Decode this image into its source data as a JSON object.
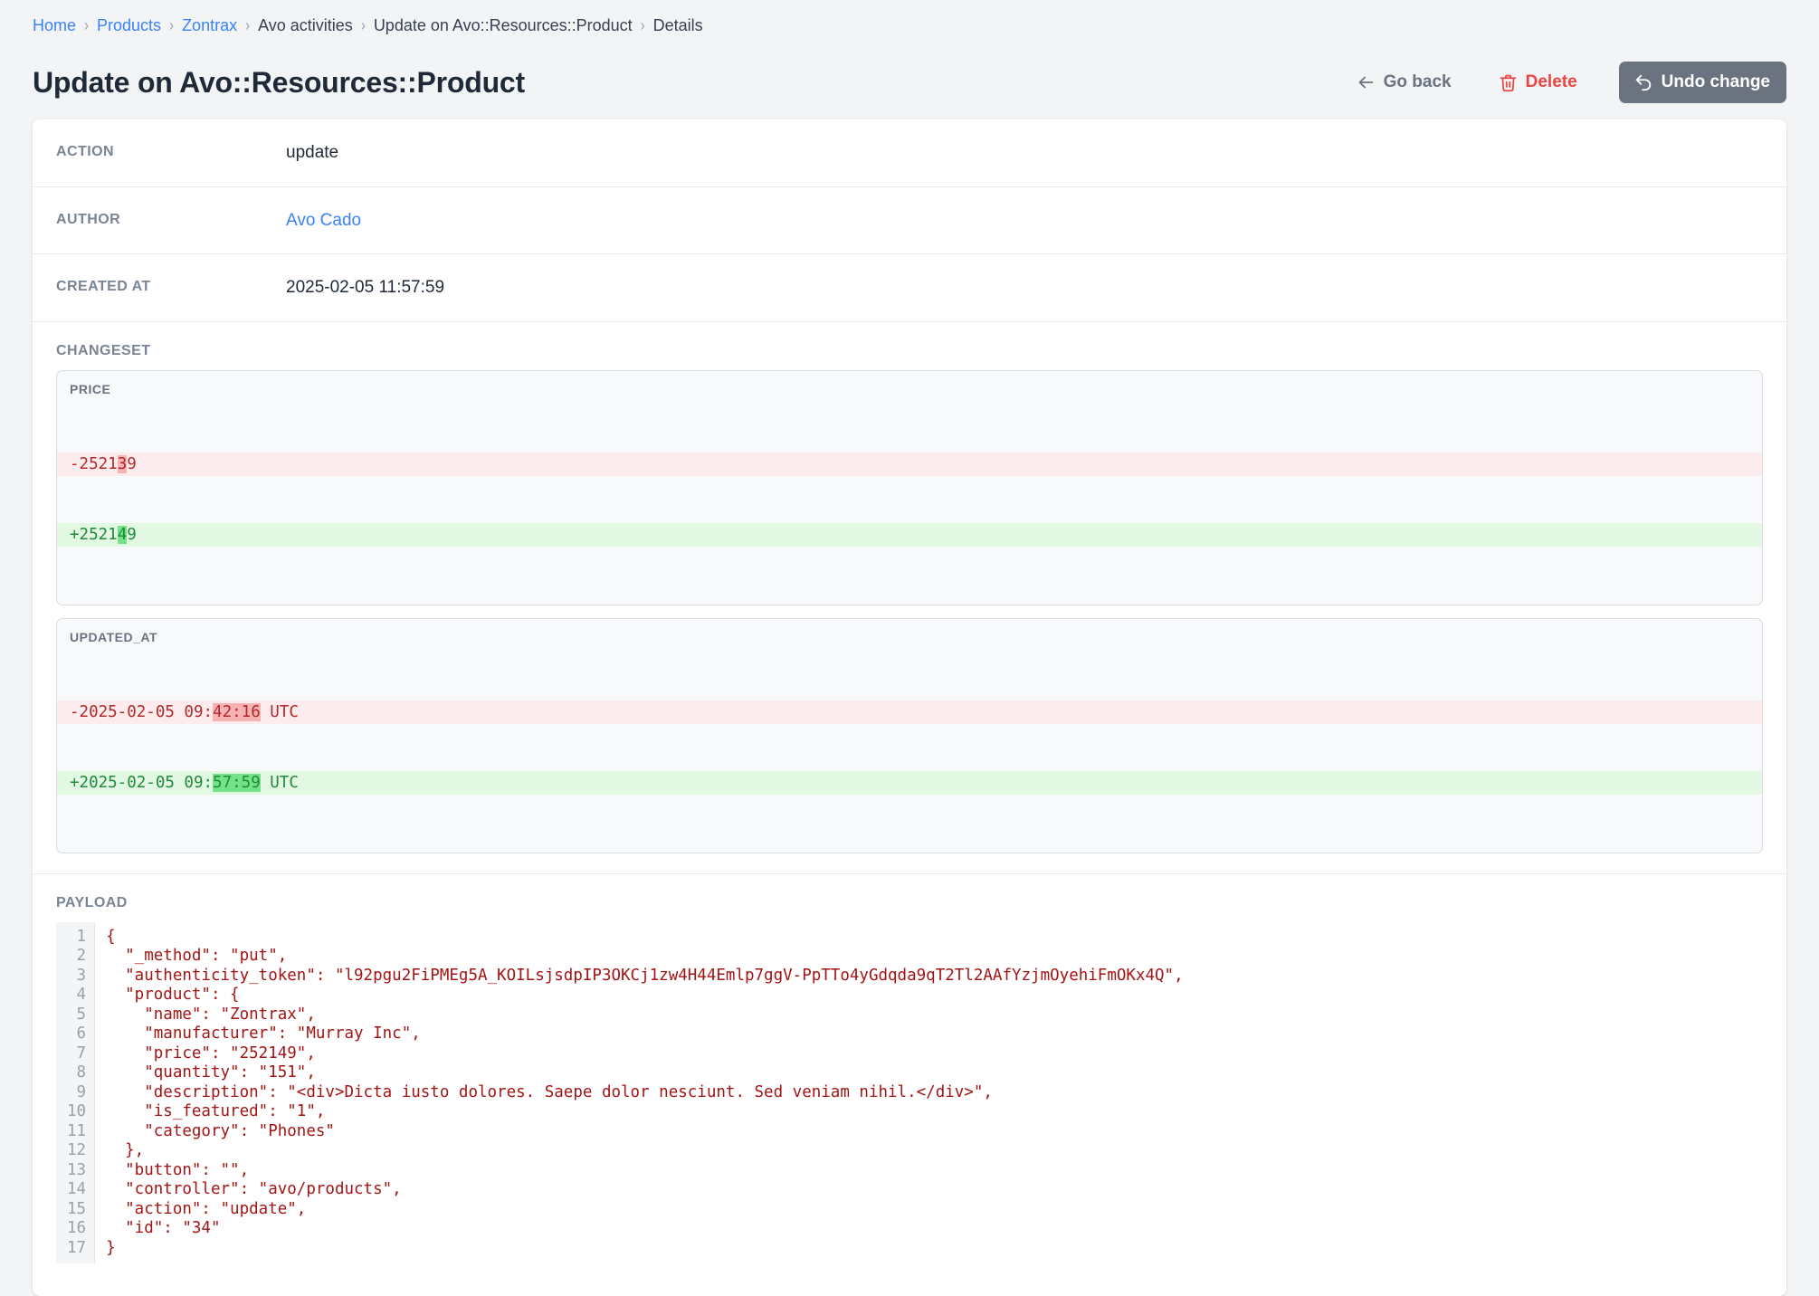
{
  "breadcrumb": {
    "separator": "›",
    "items": [
      {
        "label": "Home",
        "kind": "link"
      },
      {
        "label": "Products",
        "kind": "link"
      },
      {
        "label": "Zontrax",
        "kind": "link"
      },
      {
        "label": "Avo activities",
        "kind": "plain"
      },
      {
        "label": "Update on Avo::Resources::Product",
        "kind": "plain"
      },
      {
        "label": "Details",
        "kind": "plain"
      }
    ]
  },
  "header": {
    "title": "Update on Avo::Resources::Product",
    "go_back_label": "Go back",
    "delete_label": "Delete",
    "undo_label": "Undo change"
  },
  "colors": {
    "link": "#3b82f6",
    "danger": "#ef4444",
    "muted": "#6b7280",
    "undo_button_bg": "#6b7280",
    "diff_del_bg": "#fdeced",
    "diff_ins_bg": "#e2f8e3",
    "diff_del_hl": "#f7b2b4",
    "diff_ins_hl": "#72e387"
  },
  "fields": [
    {
      "label": "ACTION",
      "value": "update",
      "is_link": false
    },
    {
      "label": "AUTHOR",
      "value": "Avo Cado",
      "is_link": true
    },
    {
      "label": "CREATED AT",
      "value": "2025-02-05 11:57:59",
      "is_link": false
    }
  ],
  "changeset": {
    "label": "CHANGESET",
    "panels": [
      {
        "title": "PRICE",
        "removed": {
          "prefix": "-2521",
          "highlight": "3",
          "suffix": "9"
        },
        "added": {
          "prefix": "+2521",
          "highlight": "4",
          "suffix": "9"
        }
      },
      {
        "title": "UPDATED_AT",
        "removed": {
          "prefix": "-2025-02-05 09:",
          "highlight": "42:16",
          "suffix": " UTC"
        },
        "added": {
          "prefix": "+2025-02-05 09:",
          "highlight": "57:59",
          "suffix": " UTC"
        }
      }
    ]
  },
  "payload": {
    "label": "PAYLOAD",
    "line_numbers": "1\n2\n3\n4\n5\n6\n7\n8\n9\n10\n11\n12\n13\n14\n15\n16\n17",
    "code": "{\n  \"_method\": \"put\",\n  \"authenticity_token\": \"l92pgu2FiPMEg5A_KOILsjsdpIP3OKCj1zw4H44Emlp7ggV-PpTTo4yGdqda9qT2Tl2AAfYzjmOyehiFmOKx4Q\",\n  \"product\": {\n    \"name\": \"Zontrax\",\n    \"manufacturer\": \"Murray Inc\",\n    \"price\": \"252149\",\n    \"quantity\": \"151\",\n    \"description\": \"<div>Dicta iusto dolores. Saepe dolor nesciunt. Sed veniam nihil.</div>\",\n    \"is_featured\": \"1\",\n    \"category\": \"Phones\"\n  },\n  \"button\": \"\",\n  \"controller\": \"avo/products\",\n  \"action\": \"update\",\n  \"id\": \"34\"\n}"
  }
}
